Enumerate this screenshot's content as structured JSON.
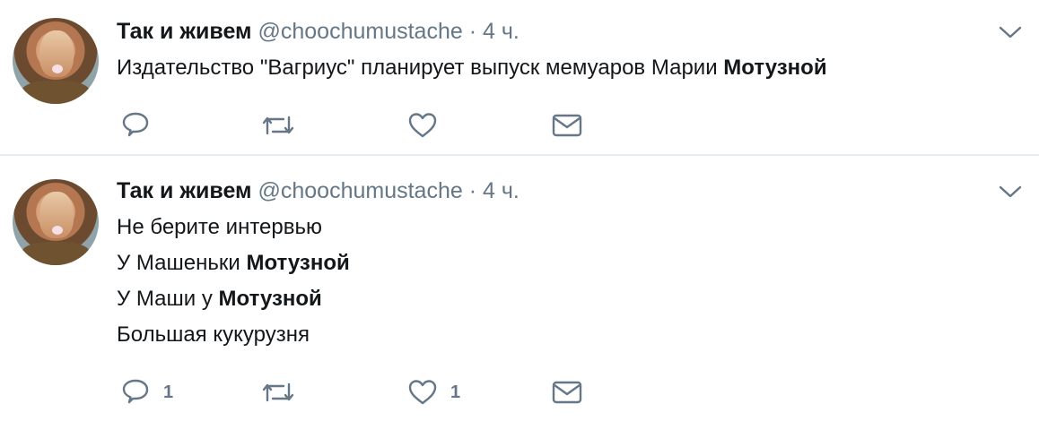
{
  "tweets": [
    {
      "name": "Так и живем",
      "handle": "@choochumustache",
      "separator": "·",
      "time": "4 ч.",
      "lines": [
        {
          "pre": "Издательство \"Вагриус\" планирует выпуск мемуаров Марии ",
          "bold": "Мотузной",
          "post": ""
        }
      ],
      "actions": {
        "reply_count": "",
        "retweet_count": "",
        "like_count": ""
      }
    },
    {
      "name": "Так и живем",
      "handle": "@choochumustache",
      "separator": "·",
      "time": "4 ч.",
      "lines": [
        {
          "pre": "Не берите интервью",
          "bold": "",
          "post": ""
        },
        {
          "pre": "У Машеньки ",
          "bold": "Мотузной",
          "post": ""
        },
        {
          "pre": "У Маши у ",
          "bold": "Мотузной",
          "post": ""
        },
        {
          "pre": "Большая кукурузня",
          "bold": "",
          "post": ""
        }
      ],
      "actions": {
        "reply_count": "1",
        "retweet_count": "",
        "like_count": "1"
      }
    }
  ],
  "icons": {
    "reply": "reply-icon",
    "retweet": "retweet-icon",
    "like": "heart-icon",
    "message": "envelope-icon",
    "menu": "chevron-down-icon"
  },
  "colors": {
    "name": "#14171a",
    "secondary": "#657786",
    "icon": "#657786",
    "divider": "#e6ecf0"
  }
}
